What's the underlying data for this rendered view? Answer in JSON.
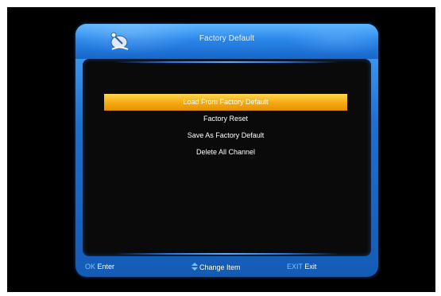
{
  "window": {
    "title": "Factory Default"
  },
  "menu": {
    "items": [
      {
        "label": "Load From Factory Default",
        "selected": true
      },
      {
        "label": "Factory Reset",
        "selected": false
      },
      {
        "label": "Save As Factory Default",
        "selected": false
      },
      {
        "label": "Delete All Channel",
        "selected": false
      }
    ]
  },
  "footer": {
    "ok_key": "OK",
    "ok_label": "Enter",
    "change_label": "Change Item",
    "exit_key": "EXIT",
    "exit_label": "Exit"
  },
  "icons": {
    "logo": "satellite-dish-logo-icon",
    "change": "up-down-arrow-icon"
  },
  "colors": {
    "frame": "#1d6fd0",
    "selected": "#f4a812",
    "panel": "#0a0a0a",
    "key_text": "#7fc2ff"
  }
}
